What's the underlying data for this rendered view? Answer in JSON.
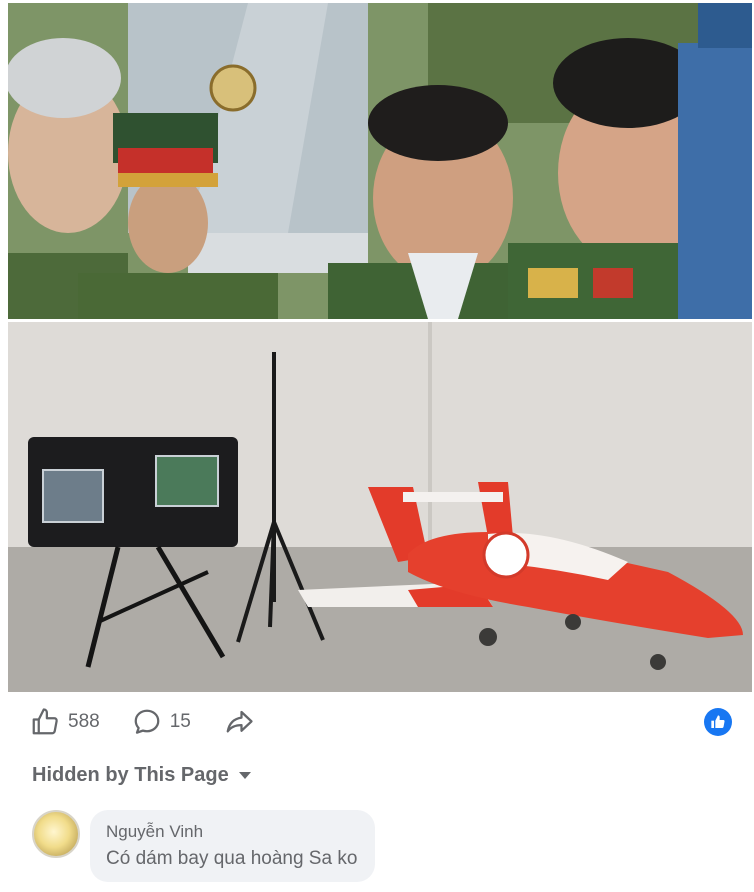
{
  "post": {
    "images": [
      {
        "description_icon": "officers-photo"
      },
      {
        "description_icon": "drone-photo"
      }
    ]
  },
  "actions": {
    "like_count": "588",
    "comment_count": "15"
  },
  "reaction_icon": "like-icon",
  "comments_filter": {
    "label": "Hidden by This Page"
  },
  "comment": {
    "author": "Nguyễn Vinh",
    "text": "Có dám bay qua hoàng Sa ko"
  },
  "colors": {
    "accent": "#1877f2",
    "secondary_text": "#65676b",
    "bubble_bg": "#f0f2f5"
  }
}
